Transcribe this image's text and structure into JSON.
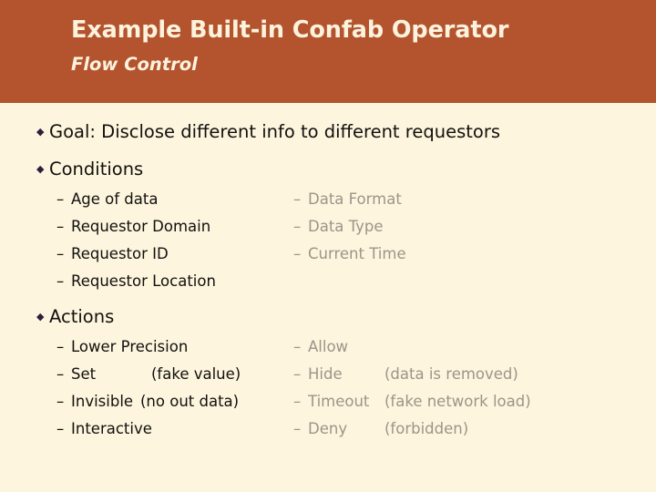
{
  "colors": {
    "header_bg": "#b3542f",
    "header_text": "#fdf3dd",
    "body_bg": "#fdf5dd",
    "body_text": "#12100f",
    "dim_text": "#9c9589",
    "bullet": "#2b1f40"
  },
  "header": {
    "title": "Example Built-in Confab Operator",
    "subtitle": "Flow Control"
  },
  "bullets": {
    "goal": "Goal: Disclose different info to different requestors",
    "conditions": "Conditions",
    "actions": "Actions"
  },
  "glyphs": {
    "bullet": "◆",
    "dash": "–"
  },
  "conditions": {
    "left": [
      {
        "label": "Age of data",
        "note": ""
      },
      {
        "label": "Requestor Domain",
        "note": ""
      },
      {
        "label": "Requestor ID",
        "note": ""
      },
      {
        "label": "Requestor Location",
        "note": ""
      }
    ],
    "right": [
      {
        "label": "Data Format",
        "note": ""
      },
      {
        "label": "Data Type",
        "note": ""
      },
      {
        "label": "Current Time",
        "note": ""
      }
    ]
  },
  "actions": {
    "left": [
      {
        "label": "Lower Precision",
        "note": ""
      },
      {
        "label": "Set",
        "note": "(fake value)"
      },
      {
        "label": "Invisible",
        "note": "(no out data)"
      },
      {
        "label": "Interactive",
        "note": ""
      }
    ],
    "right": [
      {
        "label": "Allow",
        "note": ""
      },
      {
        "label": "Hide",
        "note": "(data is removed)"
      },
      {
        "label": "Timeout",
        "note": "(fake network load)"
      },
      {
        "label": "Deny",
        "note": "(forbidden)"
      }
    ]
  }
}
